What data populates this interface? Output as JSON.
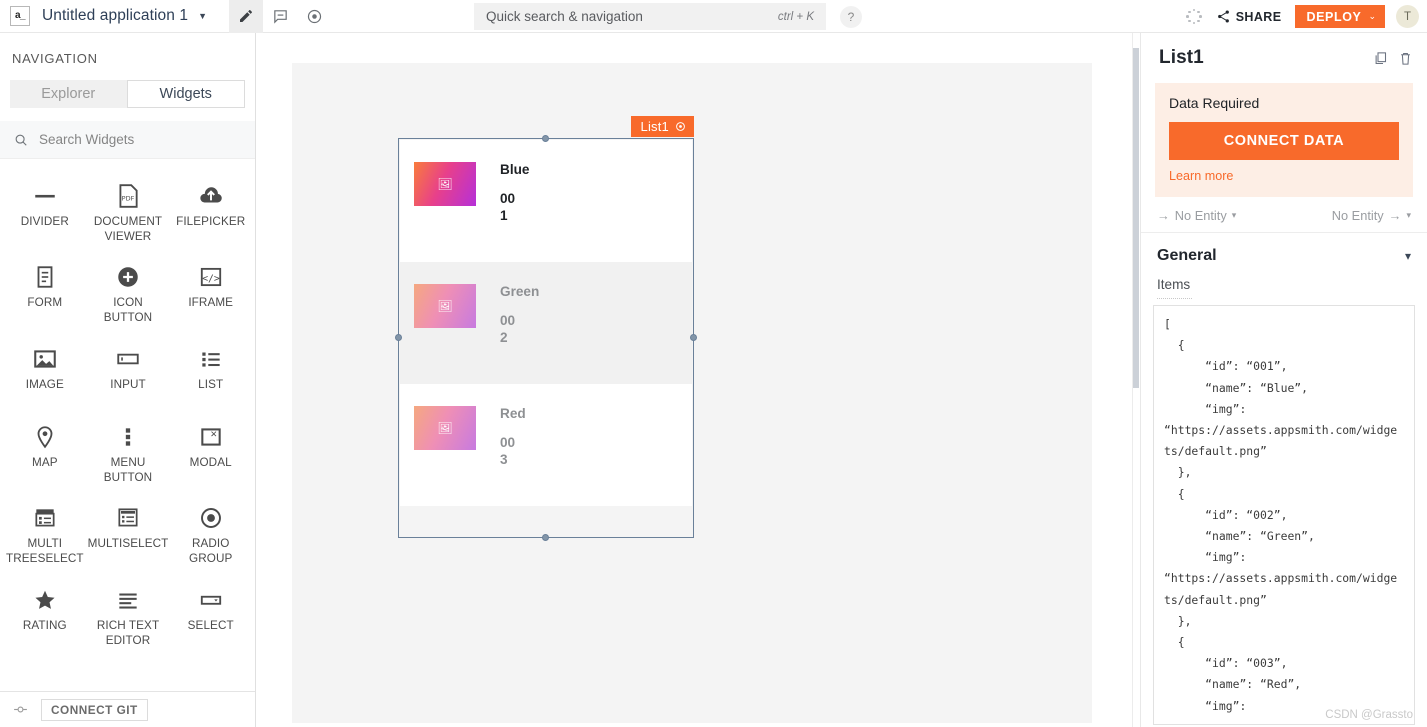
{
  "header": {
    "app_icon_glyph": "a_",
    "app_title": "Untitled application 1",
    "title_caret": "▼",
    "modes": [
      {
        "name": "edit-mode",
        "icon": "pencil-icon",
        "active": true
      },
      {
        "name": "comment-mode",
        "icon": "comment-icon",
        "active": false
      },
      {
        "name": "preview-mode",
        "icon": "eye-icon",
        "active": false
      }
    ],
    "search": {
      "placeholder": "Quick search & navigation",
      "shortcut": "ctrl + K"
    },
    "help_label": "?",
    "share_label": "SHARE",
    "deploy_label": "DEPLOY",
    "deploy_caret": "⌄",
    "avatar_initial": "T"
  },
  "sidebar": {
    "nav_title": "NAVIGATION",
    "tabs": [
      {
        "label": "Explorer",
        "active": false
      },
      {
        "label": "Widgets",
        "active": true
      }
    ],
    "search_placeholder": "Search Widgets",
    "widgets": [
      {
        "label": "DIVIDER",
        "icon": "divider-icon"
      },
      {
        "label": "DOCUMENT VIEWER",
        "icon": "document-viewer-icon"
      },
      {
        "label": "FILEPICKER",
        "icon": "filepicker-icon"
      },
      {
        "label": "FORM",
        "icon": "form-icon"
      },
      {
        "label": "ICON BUTTON",
        "icon": "icon-button-icon"
      },
      {
        "label": "IFRAME",
        "icon": "iframe-icon"
      },
      {
        "label": "IMAGE",
        "icon": "image-icon"
      },
      {
        "label": "INPUT",
        "icon": "input-icon"
      },
      {
        "label": "LIST",
        "icon": "list-icon"
      },
      {
        "label": "MAP",
        "icon": "map-pin-icon"
      },
      {
        "label": "MENU BUTTON",
        "icon": "menu-button-icon"
      },
      {
        "label": "MODAL",
        "icon": "modal-icon"
      },
      {
        "label": "MULTI TREESELECT",
        "icon": "multi-treeselect-icon"
      },
      {
        "label": "MULTISELECT",
        "icon": "multiselect-icon"
      },
      {
        "label": "RADIO GROUP",
        "icon": "radio-group-icon"
      },
      {
        "label": "RATING",
        "icon": "star-icon"
      },
      {
        "label": "RICH TEXT EDITOR",
        "icon": "rich-text-editor-icon"
      },
      {
        "label": "SELECT",
        "icon": "select-icon"
      }
    ],
    "git_label": "CONNECT GIT"
  },
  "canvas": {
    "widget_badge_name": "List1",
    "list_items": [
      {
        "name": "Blue",
        "id": "001",
        "selected": true
      },
      {
        "name": "Green",
        "id": "002",
        "selected": false
      },
      {
        "name": "Red",
        "id": "003",
        "selected": false
      }
    ]
  },
  "property_pane": {
    "title": "List1",
    "copy_icon": "copy-icon",
    "delete_icon": "trash-icon",
    "data_required_title": "Data Required",
    "connect_data_label": "CONNECT DATA",
    "learn_more_label": "Learn more",
    "entity_prev_label": "No Entity",
    "entity_next_label": "No Entity",
    "general_label": "General",
    "items_label": "Items",
    "items_code": "[\n  {\n      “id”: “001”,\n      “name”: “Blue”,\n      “img”:\n“https://assets.appsmith.com/widgets/default.png”\n  },\n  {\n      “id”: “002”,\n      “name”: “Green”,\n      “img”:\n“https://assets.appsmith.com/widgets/default.png”\n  },\n  {\n      “id”: “003”,\n      “name”: “Red”,\n      “img”:"
  },
  "watermark": "CSDN @Grassto",
  "colors": {
    "accent_orange": "#f86a2b",
    "selection_blue": "#6a8099",
    "panel_bg_peach": "#fdeee5"
  }
}
